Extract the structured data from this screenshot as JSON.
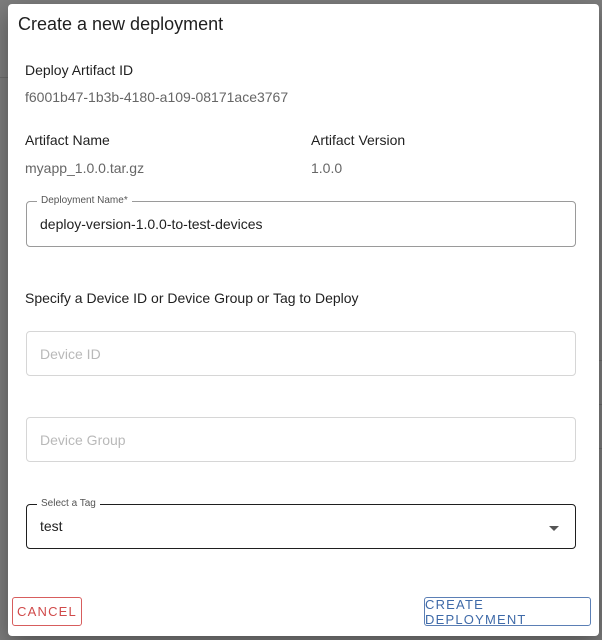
{
  "dialog": {
    "title": "Create a new deployment"
  },
  "artifact": {
    "id_label": "Deploy Artifact ID",
    "id_value": "f6001b47-1b3b-4180-a109-08171ace3767",
    "name_label": "Artifact Name",
    "name_value": "myapp_1.0.0.tar.gz",
    "version_label": "Artifact Version",
    "version_value": "1.0.0"
  },
  "deployment_name": {
    "label": "Deployment Name*",
    "value": "deploy-version-1.0.0-to-test-devices"
  },
  "target": {
    "instruction": "Specify a Device ID or Device Group or Tag to Deploy",
    "device_id_placeholder": "Device ID",
    "device_group_placeholder": "Device Group",
    "tag_label": "Select a Tag",
    "tag_value": "test"
  },
  "actions": {
    "cancel_label": "CANCEL",
    "create_label": "CREATE DEPLOYMENT"
  },
  "colors": {
    "cancel": "#d04a4a",
    "create": "#3f6aa8"
  }
}
